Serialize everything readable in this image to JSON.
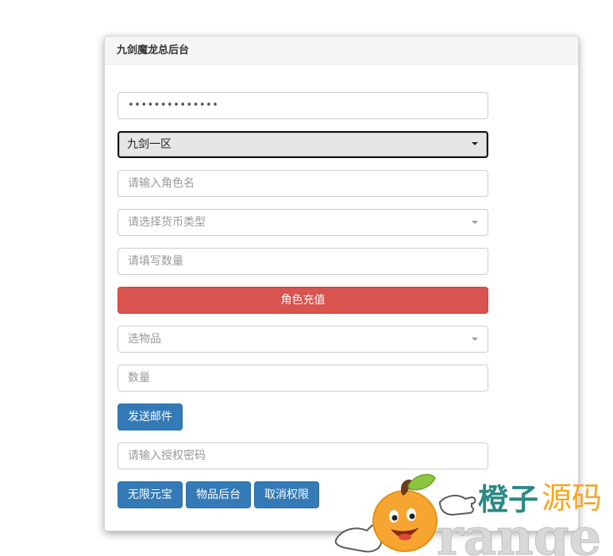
{
  "panel": {
    "title": "九剑魔龙总后台"
  },
  "form": {
    "password_mask": "••••••••••••••",
    "server_selected": "九剑一区",
    "role_name_placeholder": "请输入角色名",
    "currency_placeholder": "请选择货币类型",
    "quantity_placeholder": "请填写数量",
    "recharge_label": "角色充值",
    "item_placeholder": "选物品",
    "item_qty_placeholder": "数量",
    "send_mail_label": "发送邮件",
    "auth_password_placeholder": "请输入授权密码",
    "buttons": {
      "unlimited_ingot": "无限元宝",
      "item_backend": "物品后台",
      "revoke_permission": "取消权限"
    }
  },
  "watermark": {
    "cn_part1": "橙子",
    "cn_part2": "源码",
    "en": "range"
  },
  "colors": {
    "danger": "#d9534f",
    "primary": "#337ab7",
    "watermark_orange": "#f5a623",
    "watermark_teal": "#2a8a85"
  }
}
